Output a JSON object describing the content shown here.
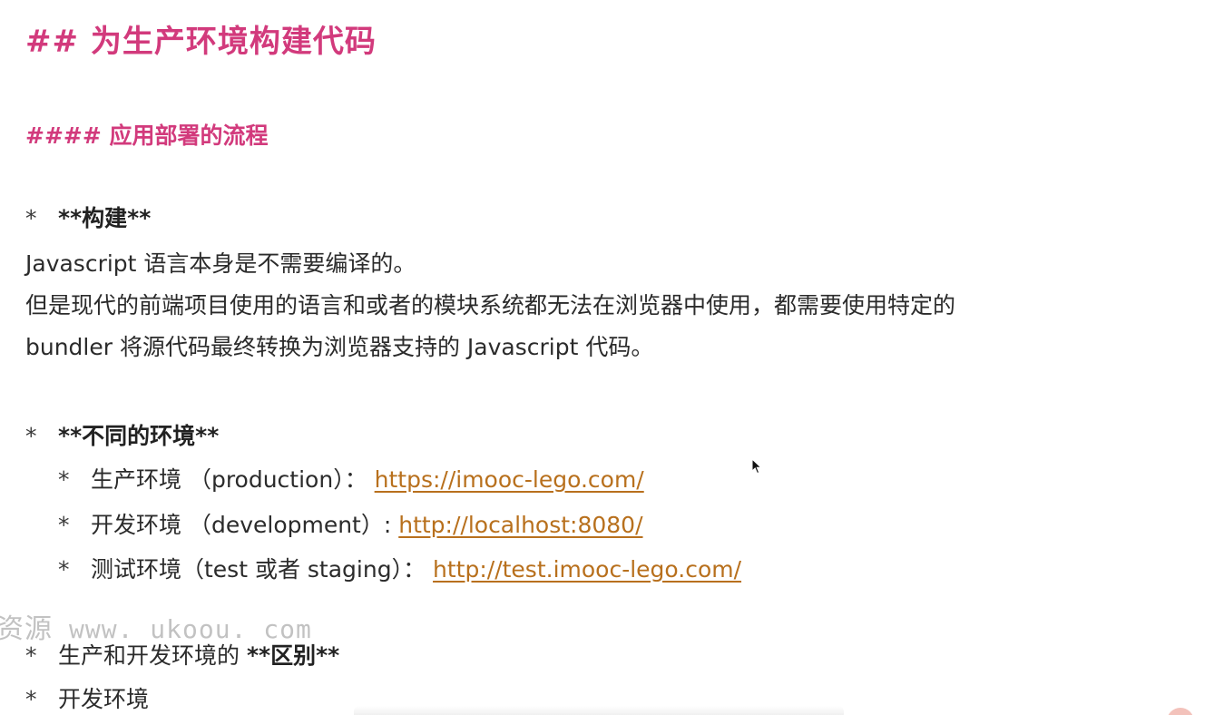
{
  "heading_main": "## 为生产环境构建代码",
  "heading_sub": "#### 应用部署的流程",
  "bullet_symbol": "*",
  "section_build": {
    "label": "**构建**",
    "lines": [
      "Javascript 语言本身是不需要编译的。",
      "但是现代的前端项目使用的语言和或者的模块系统都无法在浏览器中使用，都需要使用特定的",
      "bundler 将源代码最终转换为浏览器支持的 Javascript 代码。"
    ]
  },
  "section_envs": {
    "label": "**不同的环境**",
    "items": [
      {
        "text": "生产环境 （production）： ",
        "link": "https://imooc-lego.com/"
      },
      {
        "text": "开发环境 （development）: ",
        "link": "http://localhost:8080/"
      },
      {
        "text": "测试环境（test 或者 staging）： ",
        "link": "http://test.imooc-lego.com/"
      }
    ]
  },
  "section_diff": {
    "prefix": "生产和开发环境的 ",
    "label": "**区别**"
  },
  "section_dev": {
    "label": "开发环境"
  },
  "watermark": {
    "cn": "资源",
    "url": "www. ukoou. com"
  },
  "colors": {
    "heading": "#d23a7c",
    "link": "#b8701d",
    "text": "#2b2b2b",
    "watermark": "#b8b8b8"
  }
}
